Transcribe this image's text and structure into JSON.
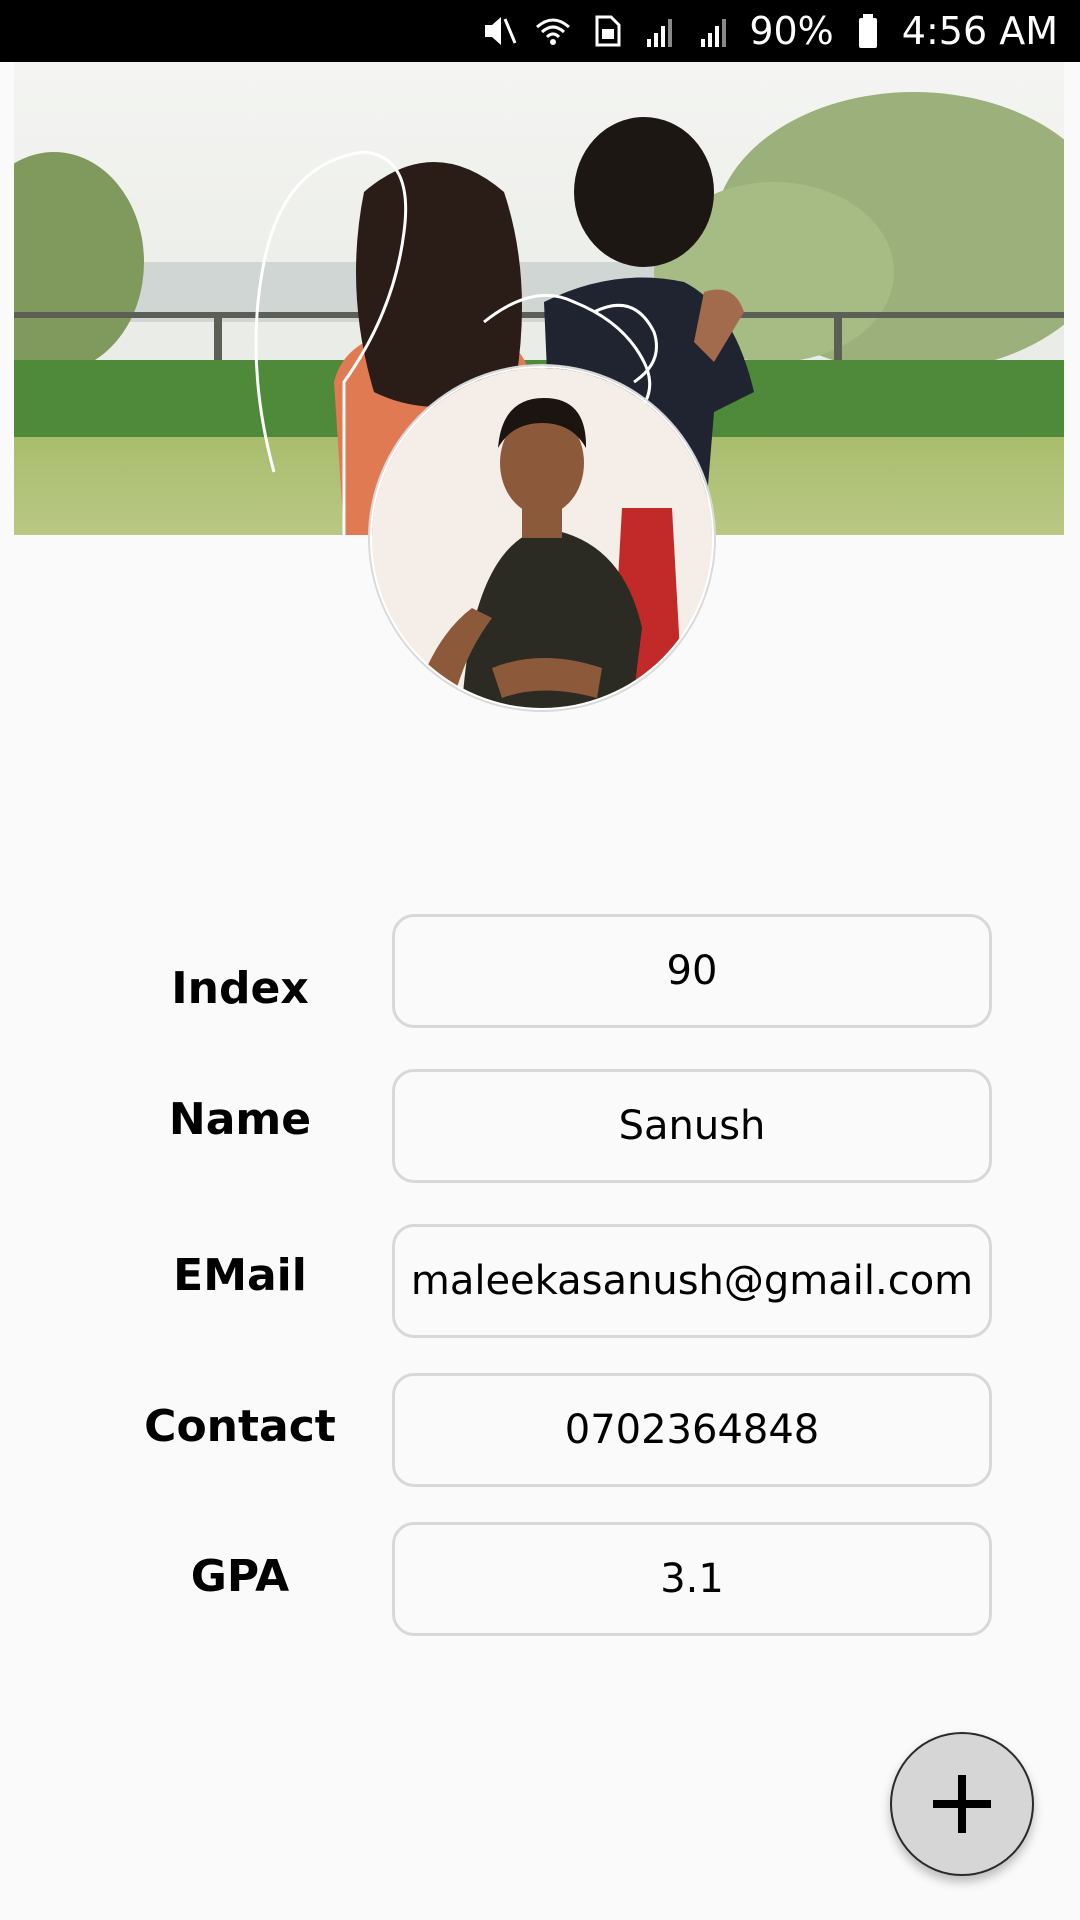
{
  "status_bar": {
    "battery": "90%",
    "time": "4:56 AM",
    "icons": [
      "mute-icon",
      "wifi-icon",
      "sim-icon",
      "signal-icon",
      "signal-icon",
      "battery-icon"
    ]
  },
  "profile": {
    "cover_image": "couple-photo",
    "avatar_image": "profile-photo"
  },
  "form": {
    "fields": [
      {
        "label": "Index",
        "value": "90"
      },
      {
        "label": "Name",
        "value": "Sanush"
      },
      {
        "label": "EMail",
        "value": "maleekasanush@gmail.com"
      },
      {
        "label": "Contact",
        "value": "0702364848"
      },
      {
        "label": "GPA",
        "value": "3.1"
      }
    ]
  },
  "fab": {
    "icon": "plus-icon"
  },
  "colors": {
    "background": "#fafafa",
    "status_bar": "#000000",
    "field_border": "#d8d8d8",
    "fab_fill": "#d6d6d6"
  }
}
